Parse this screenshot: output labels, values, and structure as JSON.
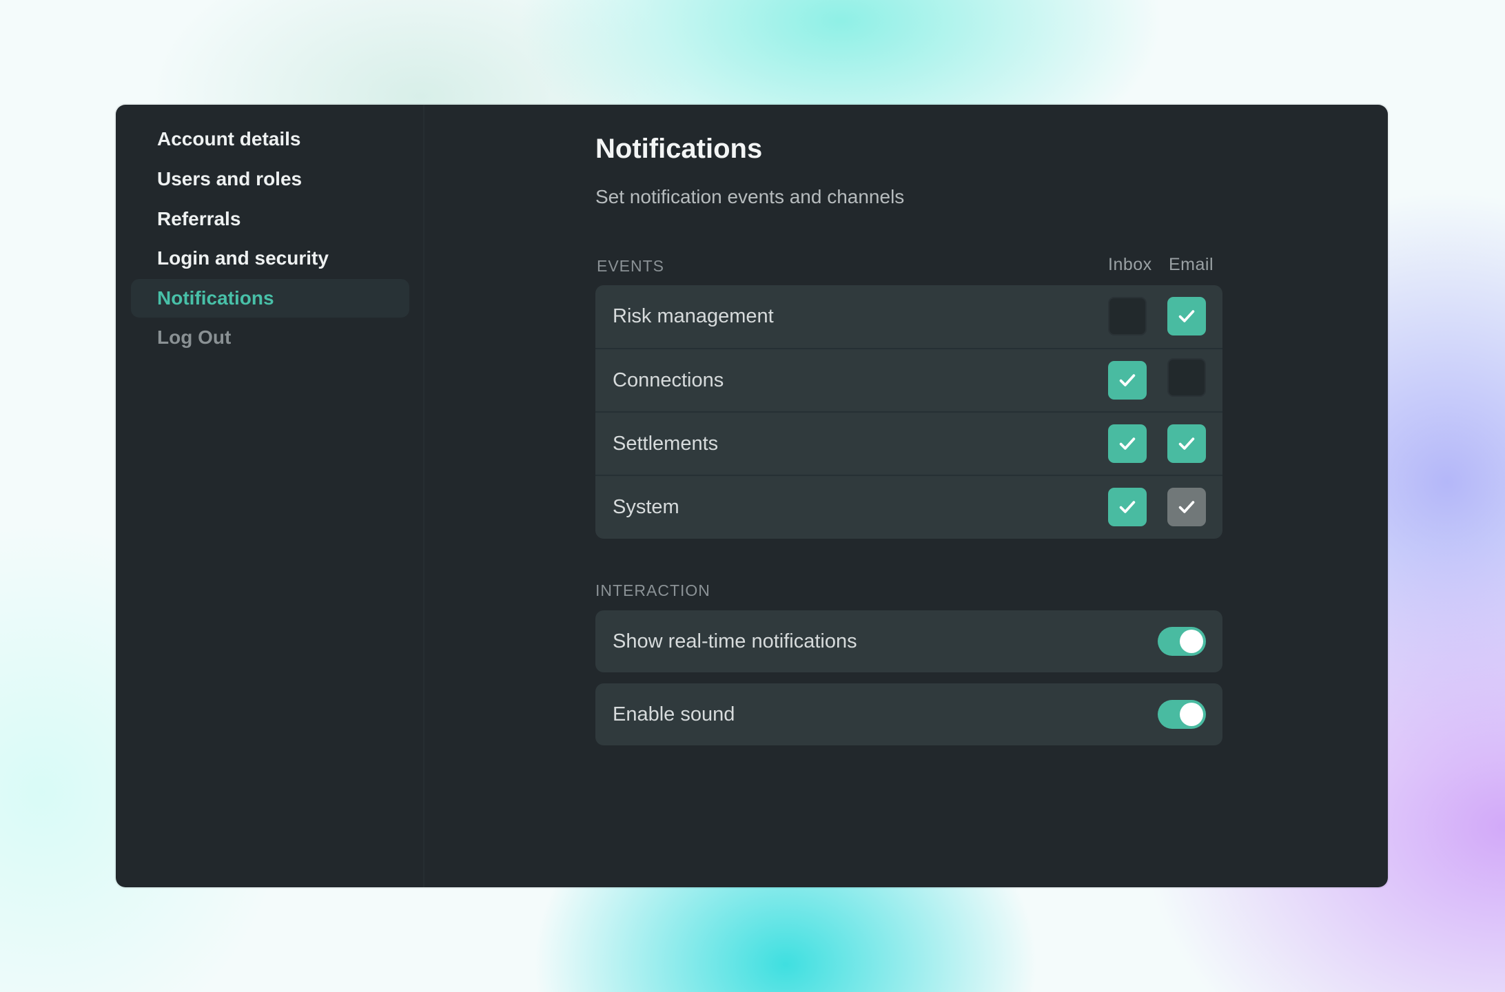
{
  "colors": {
    "accent": "#49bba1",
    "active_nav_text": "#48c0a8",
    "window_bg": "#22282c",
    "card_bg": "#303a3d"
  },
  "sidebar": {
    "items": [
      {
        "label": "Account details"
      },
      {
        "label": "Users and roles"
      },
      {
        "label": "Referrals"
      },
      {
        "label": "Login and security"
      },
      {
        "label": "Notifications",
        "active": true
      },
      {
        "label": "Log Out"
      }
    ]
  },
  "main": {
    "title": "Notifications",
    "subtitle": "Set notification events and channels",
    "events": {
      "section_label": "EVENTS",
      "columns": {
        "inbox": "Inbox",
        "email": "Email"
      },
      "rows": [
        {
          "label": "Risk management",
          "inbox": false,
          "email": true
        },
        {
          "label": "Connections",
          "inbox": true,
          "email": false
        },
        {
          "label": "Settlements",
          "inbox": true,
          "email": true
        },
        {
          "label": "System",
          "inbox": true,
          "email": "disabled-checked"
        }
      ]
    },
    "interaction": {
      "section_label": "INTERACTION",
      "toggles": [
        {
          "label": "Show real-time notifications",
          "on": true
        },
        {
          "label": "Enable sound",
          "on": true
        }
      ]
    }
  },
  "icons": {
    "check": "check-icon"
  }
}
